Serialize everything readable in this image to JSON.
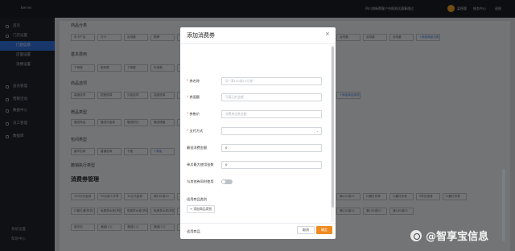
{
  "app": {
    "logo": "kerrer",
    "notice": "四川湖新牌客户合格测试通事通过",
    "user": "梁德惠",
    "links": [
      "帐务中心",
      "退账"
    ]
  },
  "sidebar": {
    "items": [
      {
        "label": "首页",
        "icon": "home-icon"
      },
      {
        "label": "门店设置",
        "icon": "store-icon"
      },
      {
        "label": "门店信息",
        "sub": true,
        "active": true
      },
      {
        "label": "店面设置",
        "sub": true
      },
      {
        "label": "消费设置",
        "sub": true
      },
      {
        "label": "会员管理",
        "icon": "member-icon"
      },
      {
        "label": "营销活动",
        "icon": "marketing-icon"
      },
      {
        "label": "数据中心",
        "icon": "data-icon"
      },
      {
        "label": "员工管理",
        "icon": "staff-icon"
      },
      {
        "label": "数据库",
        "icon": "database-icon"
      }
    ],
    "footer": [
      "系统设置",
      "帮助中心"
    ]
  },
  "background": {
    "sections": [
      {
        "title": "商品分类",
        "chips": [
          "年卡产品",
          "次卡",
          "台球桌",
          "棋牌",
          "台球桌",
          "台球桌",
          "台球桌",
          "台球桌",
          "台球桌",
          "台球桌",
          "台球桌",
          "台球桌",
          "台球桌",
          "+添加商品分类"
        ]
      },
      {
        "title": "基本费用",
        "chips": [
          "下单费",
          "服务费",
          "下单费",
          "外卖费",
          "下单费",
          "下单费",
          "下单费",
          "下单费",
          "+添加其他费用"
        ]
      },
      {
        "title": "商品选项",
        "chips": [
          "高度选项",
          "甜度选择",
          "分量选项",
          "温度选择",
          "规格选项",
          "口味选项",
          "加料",
          "温度选择",
          "甜度",
          "温度选择(1111)",
          "+添加商品选项"
        ]
      },
      {
        "title": "赠品类型",
        "chips": [
          "赠送商品",
          "赠送代金券",
          "赠送积分",
          "赠送储值",
          "+添加"
        ]
      },
      {
        "title": "包间类型",
        "chips": [
          "豪华包间",
          "普通包间",
          "卡座",
          "+添加"
        ]
      },
      {
        "title": "撤销执行类型",
        "chips": []
      },
      {
        "title": "消费券管理",
        "big": true,
        "chips": [
          "100元代金券",
          "50元新人专享",
          "10元代金券",
          "满100减10",
          "满200减30",
          "满300减50",
          "满500减80",
          "满1000减200",
          "满50减5",
          "满80减10",
          "满120减15",
          "口腹打折券",
          "口腹打折券",
          "9折优惠券",
          "口腹打折券"
        ]
      },
      {
        "title": "",
        "chips": [
          "口腹礼遇(折扣)",
          "免费茶水券(折扣)",
          "免费茶水券(折扣)",
          "免费茶水券(折扣)",
          "满200减30",
          "满300减50",
          "满500减80",
          "满1000减200",
          "满50减5",
          "满80减10",
          "满120减15",
          "满150减20",
          "满180减25"
        ]
      },
      {
        "title": "",
        "chips": [
          "豪华包",
          "满减(11)",
          "满减(11)",
          "满减(11)",
          "满减(11)",
          "满减(11)",
          "满减(11)"
        ]
      }
    ]
  },
  "modal": {
    "title": "添加消费券",
    "close": "×",
    "fields": [
      {
        "label": "券名称",
        "required": true,
        "placeholder": "如 \"满100减10元券\"",
        "value": ""
      },
      {
        "label": "券面额",
        "required": true,
        "placeholder": "可填元的金额",
        "value": ""
      },
      {
        "label": "券售价",
        "required": true,
        "placeholder": "消费券出售金额",
        "value": ""
      },
      {
        "label": "支付方式",
        "required": true,
        "placeholder": "",
        "value": "",
        "select": true
      },
      {
        "label": "最低消费金额",
        "required": false,
        "placeholder": "",
        "value": "0"
      },
      {
        "label": "单次最大使用张数",
        "required": false,
        "placeholder": "",
        "value": "0"
      }
    ],
    "toggle_label": "与其他券同时使用",
    "toggle_on": false,
    "section_category": "适用商品类别",
    "add_category": "+ 添加商品类别",
    "section_goods": "适用商品",
    "add_goods": "+ 添加商品",
    "cancel": "取消",
    "confirm": "确定"
  },
  "watermark": "@智享宝信息",
  "colors": {
    "primary": "#2f6fd6",
    "confirm": "#f08b20",
    "required": "#e0463f"
  }
}
